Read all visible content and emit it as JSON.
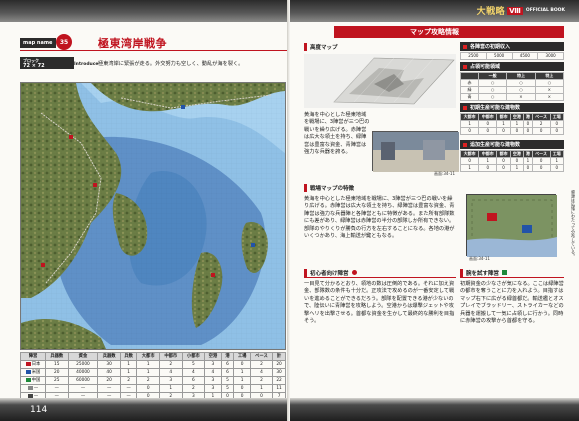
{
  "left": {
    "map_tag": "map name",
    "map_number": "35",
    "title": "極東湾岸戦争",
    "block_label": "ブロック",
    "block_size": "72 × 72",
    "intro_label": "Introduce",
    "intro_text": "極東湾岸に緊張が走る。外交努力も空しく、動乱が海を裂く。",
    "page_number": "114",
    "table": {
      "headers": [
        "陣営",
        "兵器数",
        "資金",
        "兵器数",
        "兵数",
        "大都市",
        "中都市",
        "小都市",
        "空港",
        "港",
        "工場",
        "ベース",
        "計"
      ],
      "rows": [
        [
          "日本",
          "15",
          "25000",
          "30",
          "1",
          "1",
          "2",
          "5",
          "3",
          "6",
          "0",
          "2",
          "20"
        ],
        [
          "米国",
          "20",
          "40000",
          "40",
          "1",
          "1",
          "4",
          "4",
          "4",
          "6",
          "1",
          "4",
          "30"
        ],
        [
          "中国",
          "25",
          "60000",
          "20",
          "2",
          "2",
          "3",
          "6",
          "3",
          "5",
          "1",
          "2",
          "22"
        ],
        [
          "—",
          "—",
          "—",
          "—",
          "—",
          "0",
          "1",
          "2",
          "3",
          "5",
          "0",
          "1",
          "11"
        ],
        [
          "—",
          "—",
          "—",
          "—",
          "—",
          "0",
          "2",
          "3",
          "1",
          "0",
          "0",
          "0",
          "7"
        ]
      ],
      "total": [
        "合計",
        "60",
        "125000",
        "90",
        "4",
        "4",
        "12",
        "20",
        "14",
        "22",
        "2",
        "9",
        "90"
      ]
    }
  },
  "right": {
    "logo": "大戦略",
    "logo_roman": "Ⅷ",
    "logo_sub": "OFFICIAL BOOK",
    "header": "マップ攻略情報",
    "elevation_title": "高度マップ",
    "para1": "黄海を中心とした極東地域を戦場に、3陣営が三つ巴の戦いを繰り広げる。赤陣営は広大な領土を持ち、緑陣営は豊富な資金、青陣営は強力な兵器を誇る。",
    "caption1": "画面:34-11",
    "features_title": "戦場マップの特徴",
    "para2": "黄海を中心とした極東地域を戦場に、3陣営が三つ巴の戦いを繰り広げる。赤陣営は広大な領土を持ち、緑陣営は豊富な資金、青陣営は強力な兵器陣と各陣営ともに特徴がある。また所有部隊数にも差があり、緑陣営は赤陣営の半分の部隊しか所有できない。部隊のやりくりが勝負の行方を左右することになる。各地の港がいくつかあり、海上輸送が鍵ともなる。",
    "initial_title": "初心者向け陣営",
    "para3": "一目見て分かるとおり、領地の数は圧倒的である。それに加え資金、部隊数の条件も十分だ。正攻法で攻めるのが一番安定して戦いを進めることができるだろう。部隊を配置できる港が少ないので、陸伝いに青陣営を攻略しよう。空港からは爆撃ジェットや攻撃ヘリを出撃させる。首都な資金を生かして最終的な勝利を目指そう。",
    "initial_forces": {
      "title": "各陣営の初期収入",
      "cols": [
        "2500",
        "5000",
        "4500",
        "3000"
      ]
    },
    "areas": {
      "title": "占領可能領域",
      "headers": [
        "",
        "一般",
        "特上",
        "特上"
      ],
      "rows": [
        [
          "赤",
          "○",
          "○",
          "○"
        ],
        [
          "緑",
          "○",
          "○",
          "×"
        ],
        [
          "青",
          "○",
          "×",
          "×"
        ]
      ]
    },
    "production1": {
      "title": "初期生産可能な建物数",
      "headers": [
        "大都市",
        "中都市",
        "都市",
        "空港",
        "港",
        "ベース",
        "工場"
      ],
      "rows": [
        [
          "1",
          "0",
          "1",
          "1",
          "0",
          "2",
          "0"
        ],
        [
          "0",
          "0",
          "0",
          "0",
          "0",
          "0",
          "0"
        ]
      ]
    },
    "production2": {
      "title": "追加生産可能な建物数",
      "headers": [
        "大都市",
        "中都市",
        "都市",
        "空港",
        "港",
        "ベース",
        "工場"
      ],
      "rows": [
        [
          "0",
          "1",
          "0",
          "0",
          "1",
          "0",
          "1"
        ],
        [
          "1",
          "0",
          "0",
          "1",
          "0",
          "0",
          "0"
        ]
      ]
    },
    "caption2": "画面:34-11",
    "side_note": "資源は広域にわたって分布している。",
    "defeat_title": "腕を試す陣営",
    "para4": "初期資金の少なさが気になる。ここは緑陣営の都市を奪うことに力を入れよう。目指すはマップ右下に広がる緑首都だ。輸送艦とオスプレイでブラッドリー、ストライカーなどの兵器を運搬して一気に占領しに行かう。同時に赤陣営の攻撃から首都を守る。"
  }
}
